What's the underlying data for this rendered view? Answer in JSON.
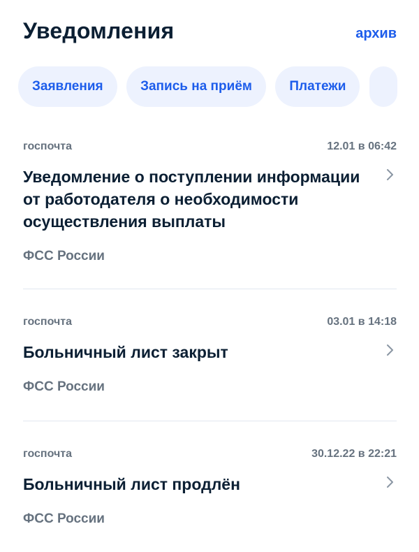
{
  "header": {
    "title": "Уведомления",
    "archive_link": "архив"
  },
  "filter_chips": [
    {
      "label": "Заявления"
    },
    {
      "label": "Запись на приём"
    },
    {
      "label": "Платежи"
    }
  ],
  "notifications": [
    {
      "source": "госпочта",
      "datetime": "12.01 в 06:42",
      "title": "Уведомление о поступлении информации от работодателя о необходимости осуществления выплаты",
      "organization": "ФСС России"
    },
    {
      "source": "госпочта",
      "datetime": "03.01 в 14:18",
      "title": "Больничный лист закрыт",
      "organization": "ФСС России"
    },
    {
      "source": "госпочта",
      "datetime": "30.12.22 в 22:21",
      "title": "Больничный лист продлён",
      "organization": "ФСС России"
    }
  ],
  "colors": {
    "accent": "#1d5deb",
    "chip_background": "#edf2fe",
    "text_primary": "#0b1f33",
    "text_secondary": "#66727f",
    "divider": "#e1e7f0"
  },
  "icons": {
    "chevron": "chevron-right-icon"
  }
}
